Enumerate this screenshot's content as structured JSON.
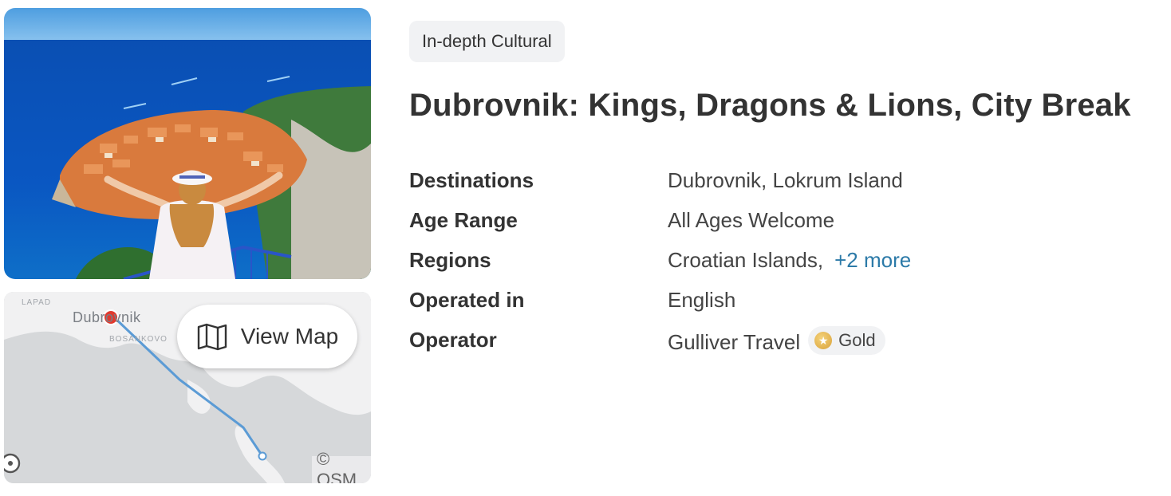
{
  "tour": {
    "tag": "In-depth Cultural",
    "title": "Dubrovnik: Kings, Dragons & Lions, City Break"
  },
  "details": {
    "destinations_label": "Destinations",
    "destinations_value": "Dubrovnik, Lokrum Island",
    "age_label": "Age Range",
    "age_value": "All Ages Welcome",
    "regions_label": "Regions",
    "regions_value": "Croatian Islands,",
    "regions_more": "+2 more",
    "operated_label": "Operated in",
    "operated_value": "English",
    "operator_label": "Operator",
    "operator_value": "Gulliver Travel",
    "operator_badge": "Gold"
  },
  "map": {
    "button_label": "View Map",
    "city_label": "Dubrovnik",
    "district_label": "LAPAD",
    "street_label": "BOSANKOVO",
    "attribution": "© OSM"
  },
  "icons": {
    "map_button": "map-icon",
    "badge": "star-coin-icon",
    "marker": "map-pin-icon"
  },
  "colors": {
    "link": "#2c7aa8",
    "route": "#5b9bd5",
    "pin": "#e03a2f",
    "badge_gold": "#d9a23a"
  }
}
